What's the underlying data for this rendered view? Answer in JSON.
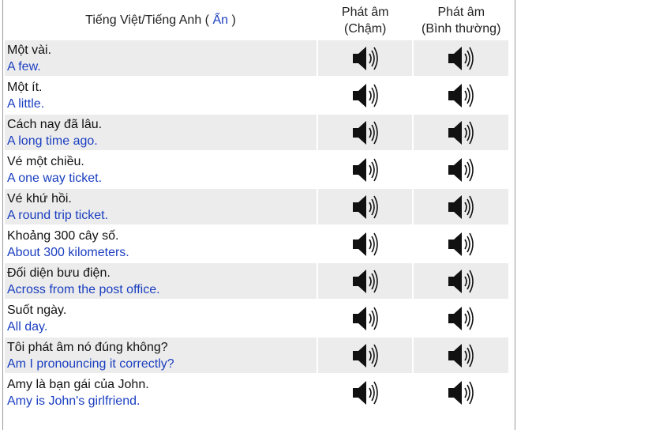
{
  "header": {
    "col1_label": "Tiếng Việt/Tiếng Anh (",
    "col1_toggle": "Ẩn",
    "col1_close": ")",
    "col2_line1": "Phát âm",
    "col2_line2": "(Chậm)",
    "col3_line1": "Phát âm",
    "col3_line2": "(Bình thường)"
  },
  "rows": [
    {
      "vi": "Một vài.",
      "en": "A few."
    },
    {
      "vi": "Một ít.",
      "en": "A little."
    },
    {
      "vi": "Cách nay đã lâu.",
      "en": "A long time ago."
    },
    {
      "vi": "Vé một chiều.",
      "en": "A one way ticket."
    },
    {
      "vi": "Vé khứ hồi.",
      "en": "A round trip ticket."
    },
    {
      "vi": "Khoảng 300 cây số.",
      "en": "About 300 kilometers."
    },
    {
      "vi": "Đối diện bưu điện.",
      "en": "Across from the post office."
    },
    {
      "vi": "Suốt ngày.",
      "en": "All day."
    },
    {
      "vi": "Tôi phát âm nó đúng không?",
      "en": "Am I pronouncing it correctly?"
    },
    {
      "vi": "Amy là bạn gái của John.",
      "en": "Amy is John's girlfriend."
    }
  ],
  "icons": {
    "play_slow": "speaker-icon",
    "play_normal": "speaker-icon"
  },
  "colors": {
    "english_text": "#1a3ec0",
    "row_alt_bg": "#ececec"
  }
}
